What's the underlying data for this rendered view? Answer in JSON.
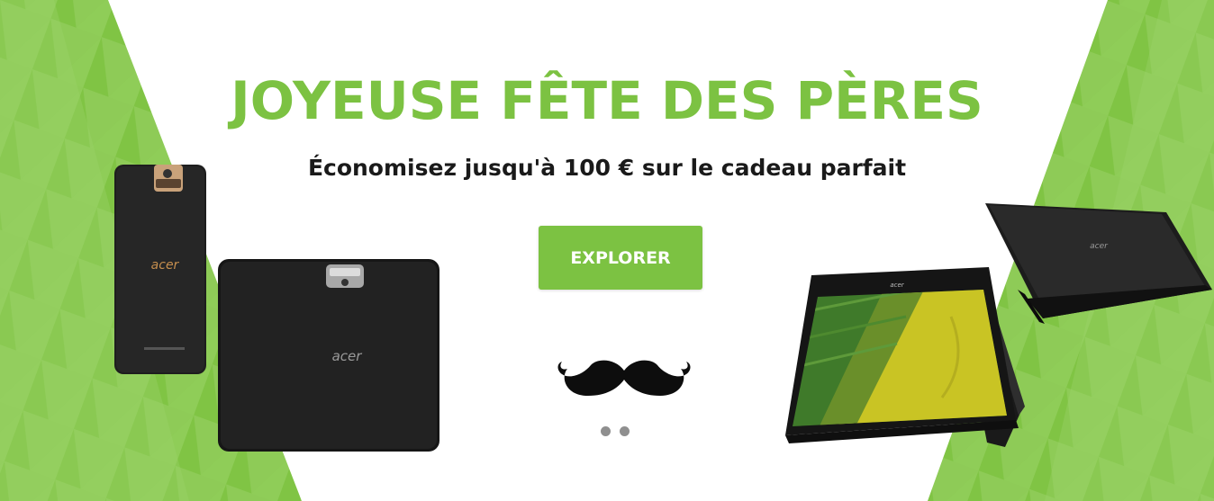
{
  "banner": {
    "title": "JOYEUSE FÊTE DES PÈRES",
    "subtitle": "Économisez jusqu'à 100 € sur le cadeau parfait",
    "cta_label": "EXPLORER"
  },
  "products": {
    "phone_brand": "acer",
    "tablet_brand": "acer",
    "laptop_brand": "acer"
  },
  "carousel": {
    "slide_count": 2
  },
  "colors": {
    "accent_green": "#7cc242",
    "light_green": "#a6d97a",
    "text_dark": "#1a1a1a",
    "white": "#ffffff"
  },
  "icons": [
    "mustache-icon",
    "carousel-dot"
  ]
}
